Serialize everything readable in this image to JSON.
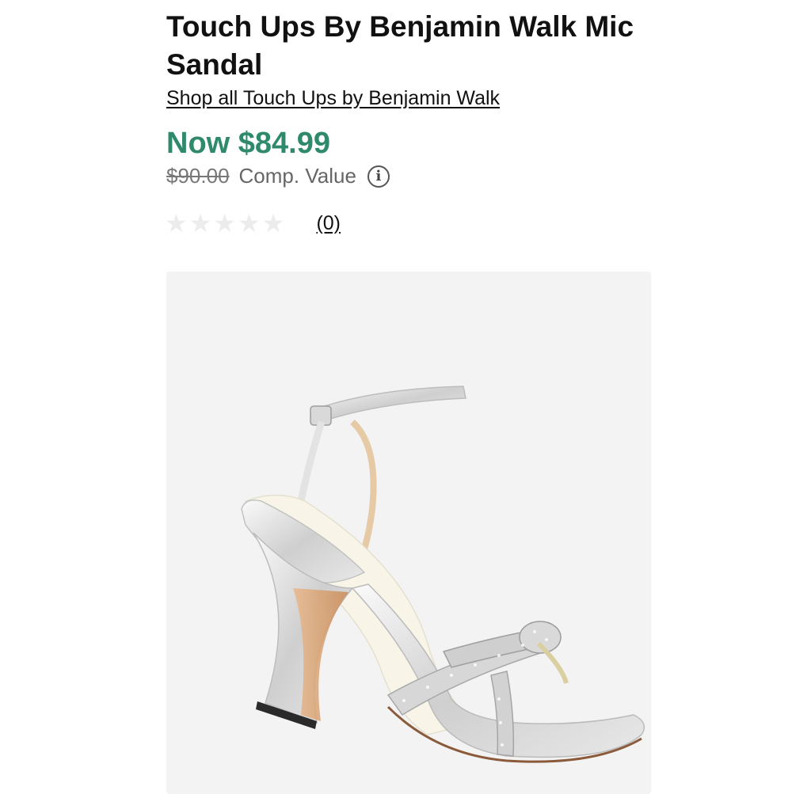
{
  "product": {
    "title": "Touch Ups By Benjamin Walk Mic\nSandal",
    "brand_link": "Shop all Touch Ups by Benjamin Walk"
  },
  "pricing": {
    "now_price": "Now $84.99",
    "original_price": "$90.00",
    "comp_label": "Comp. Value",
    "info_icon_glyph": "i",
    "now_color": "#2f8a6b"
  },
  "rating": {
    "stars_filled": 0,
    "stars_total": 5,
    "review_count": "(0)"
  },
  "image": {
    "icon": "sandal-product-image",
    "background": "#f3f3f3"
  }
}
